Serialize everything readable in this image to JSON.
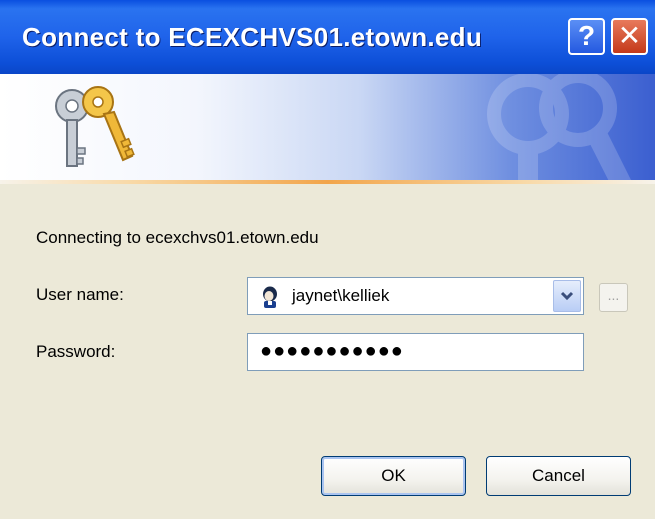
{
  "window": {
    "title": "Connect to ECEXCHVS01.etown.edu",
    "help_label": "?",
    "close_label": "✕"
  },
  "banner": {
    "icon": "keys-icon",
    "watermark_icon": "keys-watermark-icon"
  },
  "dialog": {
    "connecting_text": "Connecting to ecexchvs01.etown.edu",
    "username_label": "User name:",
    "username_value": "jaynet\\kelliek",
    "browse_label": "...",
    "password_label": "Password:",
    "password_value": "●●●●●●●●●●●",
    "ok_label": "OK",
    "cancel_label": "Cancel"
  },
  "colors": {
    "titlebar": "#1f63ea",
    "dialog_bg": "#ece9d8",
    "accent_line": "#f2a54b"
  }
}
